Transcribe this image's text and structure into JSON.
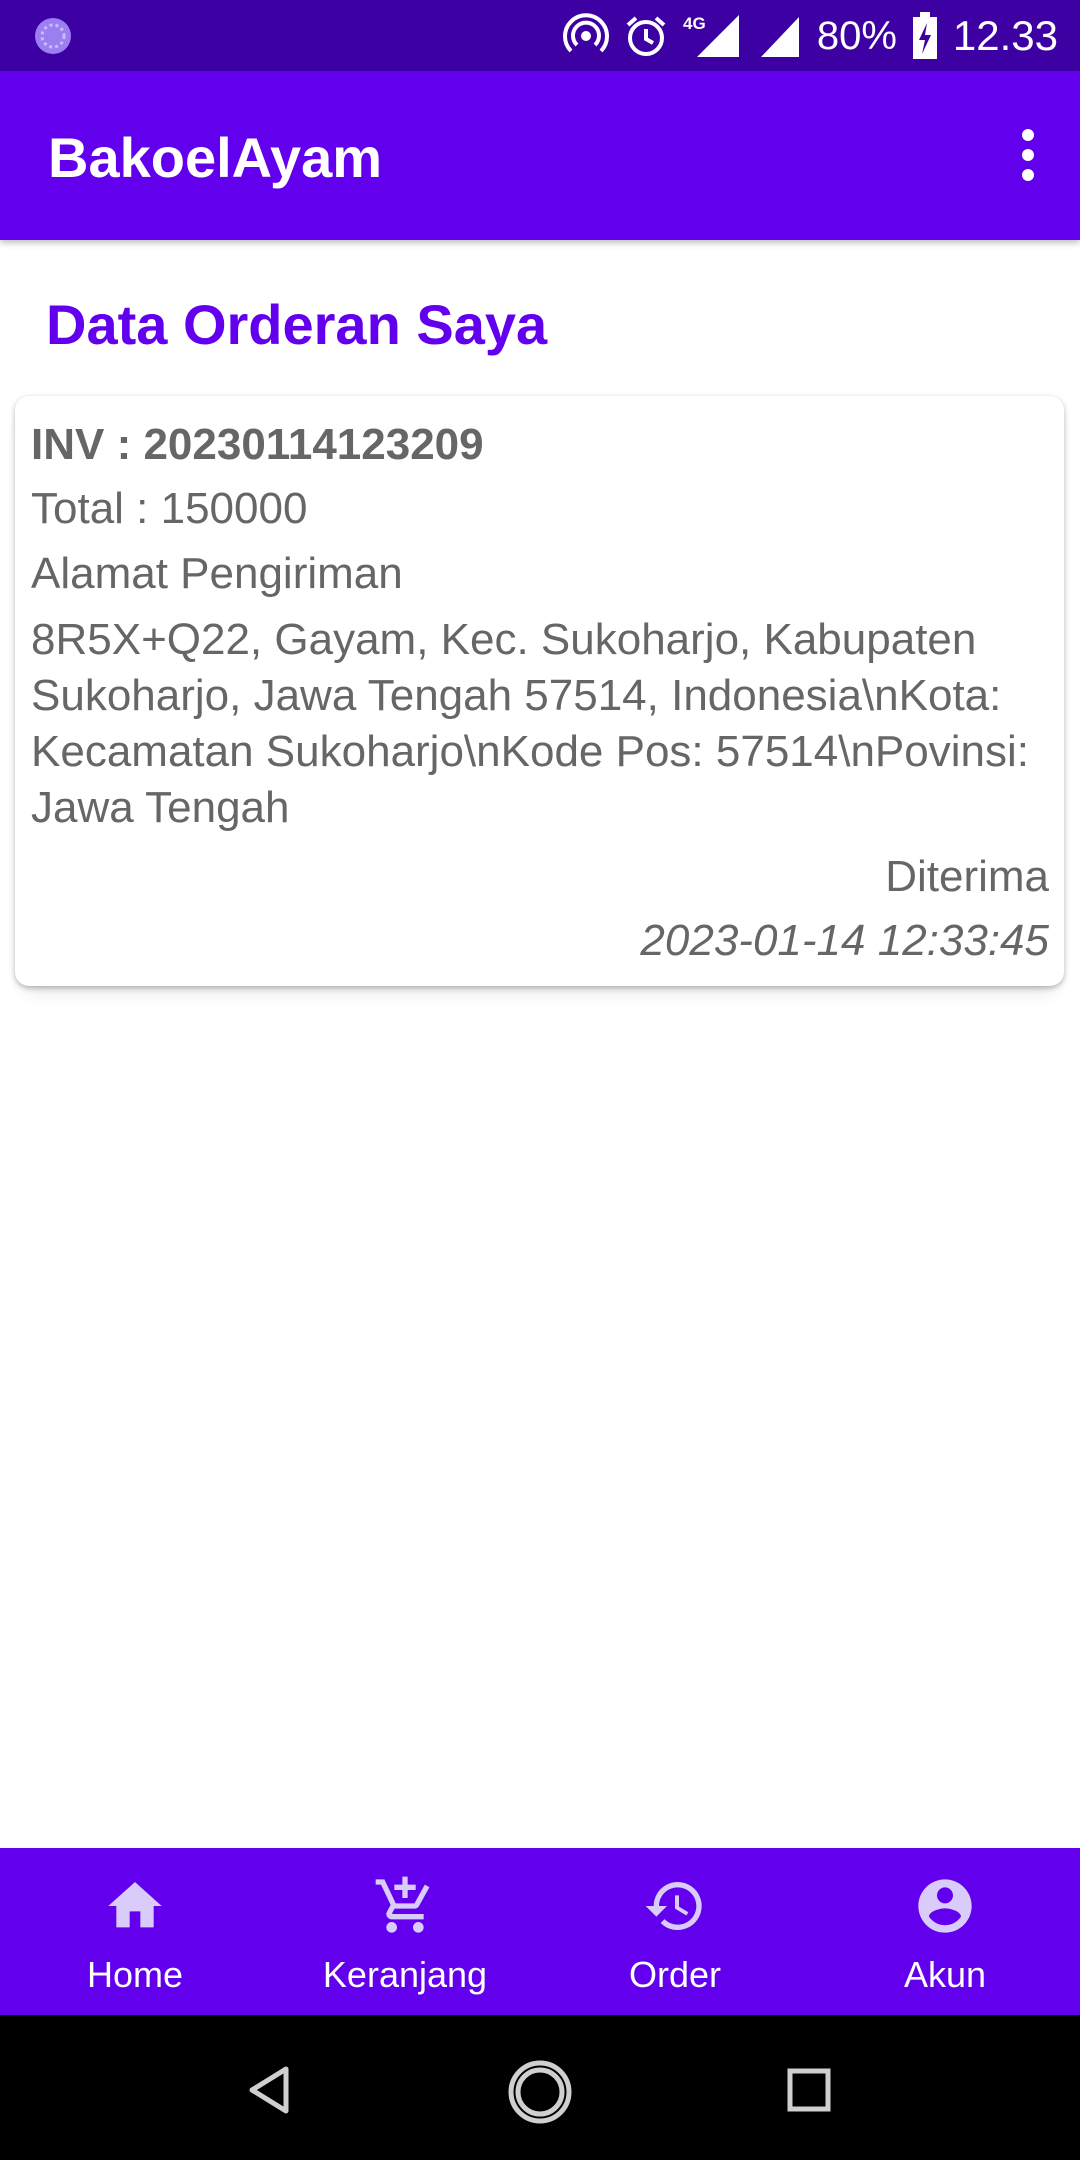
{
  "status_bar": {
    "battery": "80%",
    "time": "12.33",
    "network": "4G",
    "icons": [
      "circle-notification-icon",
      "hotspot-icon",
      "alarm-icon",
      "signal-4g-icon",
      "signal-icon",
      "battery-charging-icon"
    ]
  },
  "app_bar": {
    "title": "BakoelAyam",
    "overflow_icon": "more-vert-icon"
  },
  "page": {
    "title": "Data Orderan Saya"
  },
  "orders": [
    {
      "inv": "INV : 20230114123209",
      "total": "Total : 150000",
      "address_label": "Alamat Pengiriman",
      "address": "8R5X+Q22, Gayam, Kec. Sukoharjo, Kabupaten Sukoharjo, Jawa Tengah 57514, Indonesia\\nKota: Kecamatan Sukoharjo\\nKode Pos: 57514\\nPovinsi: Jawa Tengah",
      "status": "Diterima",
      "datetime": "2023-01-14 12:33:45"
    }
  ],
  "bottom_nav": {
    "items": [
      {
        "label": "Home",
        "icon": "home-icon"
      },
      {
        "label": "Keranjang",
        "icon": "add-cart-icon"
      },
      {
        "label": "Order",
        "icon": "history-icon"
      },
      {
        "label": "Akun",
        "icon": "account-icon"
      }
    ]
  },
  "system_nav": {
    "icons": [
      "back-icon",
      "home-circle-icon",
      "recents-icon"
    ]
  },
  "colors": {
    "primary": "#6200ee",
    "status_bar": "#3d01a3",
    "text_gray": "#666666"
  }
}
